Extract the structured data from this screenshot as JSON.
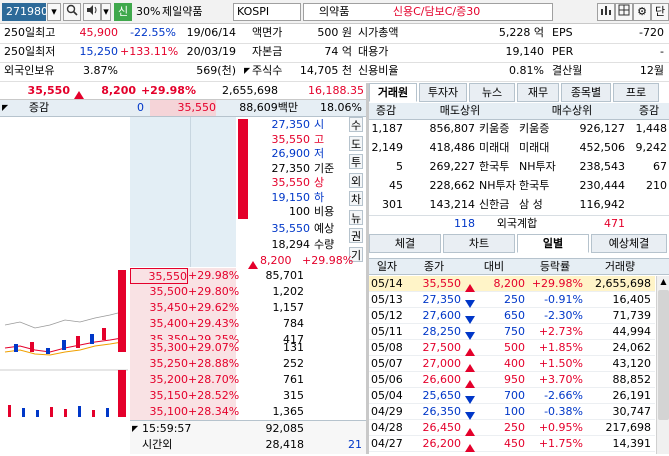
{
  "toolbar": {
    "code": "271980",
    "market_badge": "신",
    "margin": "30%",
    "name": "제일약품",
    "market": "KOSPI",
    "sector": "의약품",
    "credit": "신용C/담보C/증30",
    "end_btn": "단"
  },
  "info": {
    "row1": {
      "l1": "250일최고",
      "v1": "45,900",
      "p1": "-22.55%",
      "d1": "19/06/14",
      "l2": "액면가",
      "v2": "500 원",
      "l3": "시가총액",
      "v3": "5,228 억",
      "l4": "EPS",
      "v4": "-720"
    },
    "row2": {
      "l1": "250일최저",
      "v1": "15,250",
      "p1": "+133.11%",
      "d1": "20/03/19",
      "l2": "자본금",
      "v2": "74 억",
      "l3": "대용가",
      "v3": "19,140",
      "l4": "PER",
      "v4": "-"
    },
    "row3": {
      "l1": "외국인보유",
      "v1": "3.87%",
      "v1b": "569(천)",
      "l2": "주식수",
      "v2": "14,705 천",
      "l3": "신용비율",
      "v3": "0.81%",
      "l4": "결산월",
      "v4": "12월"
    }
  },
  "pricebar": {
    "price": "35,550",
    "change": "8,200",
    "rate": "+29.98%",
    "volume": "2,655,698",
    "amount": "16,188.35"
  },
  "order": {
    "hdr_label": "증감",
    "hdr_zero": "0",
    "hdr_price": "35,550",
    "hdr_amount": "88,609백만",
    "hdr_pct": "18.06%",
    "ohlc": [
      {
        "val": "27,350",
        "label": "시",
        "color": "blue"
      },
      {
        "val": "35,550",
        "label": "고",
        "color": "red"
      },
      {
        "val": "26,900",
        "label": "저",
        "color": "blue"
      },
      {
        "val": "27,350",
        "label": "기준",
        "color": "black"
      },
      {
        "val": "35,550",
        "label": "상",
        "color": "red"
      },
      {
        "val": "19,150",
        "label": "하",
        "color": "blue"
      },
      {
        "val": "100",
        "label": "비용",
        "color": "black"
      }
    ],
    "expected_label": "예상",
    "expected_val": "35,550",
    "qty_label": "수량",
    "qty_val": "18,294",
    "exp_change": "8,200",
    "exp_rate": "+29.98%",
    "side_menu": [
      "수",
      "도",
      "투",
      "외",
      "차",
      "뉴",
      "권",
      "기"
    ],
    "ask_rows": [
      {
        "price": "35,550",
        "rate": "+29.98%",
        "qty": "85,701"
      },
      {
        "price": "35,500",
        "rate": "+29.80%",
        "qty": "1,202"
      },
      {
        "price": "35,450",
        "rate": "+29.62%",
        "qty": "1,157"
      },
      {
        "price": "35,400",
        "rate": "+29.43%",
        "qty": "784"
      },
      {
        "price": "35,350",
        "rate": "+29.25%",
        "qty": "417"
      }
    ],
    "bid_rows": [
      {
        "price": "35,300",
        "rate": "+29.07%",
        "qty": "131"
      },
      {
        "price": "35,250",
        "rate": "+28.88%",
        "qty": "252"
      },
      {
        "price": "35,200",
        "rate": "+28.70%",
        "qty": "761"
      },
      {
        "price": "35,150",
        "rate": "+28.52%",
        "qty": "315"
      },
      {
        "price": "35,100",
        "rate": "+28.34%",
        "qty": "1,365"
      }
    ],
    "time": "15:59:57",
    "total": "92,085",
    "after_label": "시간외",
    "after_val": "28,418",
    "after_extra": "21"
  },
  "right_tabs": [
    "거래원",
    "투자자",
    "뉴스",
    "재무",
    "종목별",
    "프로"
  ],
  "broker": {
    "headers": [
      "증감",
      "매도상위",
      "매수상위",
      "증감"
    ],
    "rows": [
      {
        "d1": "1,187",
        "sv": "856,807",
        "sn": "키움증",
        "bn": "키움증",
        "bv": "926,127",
        "d2": "1,448"
      },
      {
        "d1": "2,149",
        "sv": "418,486",
        "sn": "미래대",
        "bn": "미래대",
        "bv": "452,506",
        "d2": "9,242"
      },
      {
        "d1": "5",
        "sv": "269,227",
        "sn": "한국투",
        "bn": "NH투자",
        "bv": "238,543",
        "d2": "67"
      },
      {
        "d1": "45",
        "sv": "228,662",
        "sn": "NH투자",
        "bn": "한국투",
        "bv": "230,444",
        "d2": "210"
      },
      {
        "d1": "301",
        "sv": "143,214",
        "sn": "신한금",
        "bn": "삼  성",
        "bv": "116,942",
        "d2": ""
      }
    ],
    "foreign_left": "118",
    "foreign_label": "외국계합",
    "foreign_right": "471"
  },
  "bottom_tabs": [
    "체결",
    "차트",
    "일별",
    "예상체결"
  ],
  "daily": {
    "headers": [
      "일자",
      "종가",
      "대비",
      "등락률",
      "거래량"
    ],
    "rows": [
      {
        "date": "05/14",
        "close": "35,550",
        "dir": "up",
        "chg": "8,200",
        "rate": "+29.98%",
        "vol": "2,655,698"
      },
      {
        "date": "05/13",
        "close": "27,350",
        "dir": "dn",
        "chg": "250",
        "rate": "-0.91%",
        "vol": "16,405"
      },
      {
        "date": "05/12",
        "close": "27,600",
        "dir": "dn",
        "chg": "650",
        "rate": "-2.30%",
        "vol": "71,739"
      },
      {
        "date": "05/11",
        "close": "28,250",
        "dir": "dn",
        "chg": "750",
        "rate": "+2.73%",
        "vol": "44,994"
      },
      {
        "date": "05/08",
        "close": "27,500",
        "dir": "up",
        "chg": "500",
        "rate": "+1.85%",
        "vol": "24,062"
      },
      {
        "date": "05/07",
        "close": "27,000",
        "dir": "up",
        "chg": "400",
        "rate": "+1.50%",
        "vol": "43,120"
      },
      {
        "date": "05/06",
        "close": "26,600",
        "dir": "up",
        "chg": "950",
        "rate": "+3.70%",
        "vol": "88,852"
      },
      {
        "date": "05/04",
        "close": "25,650",
        "dir": "dn",
        "chg": "700",
        "rate": "-2.66%",
        "vol": "26,191"
      },
      {
        "date": "04/29",
        "close": "26,350",
        "dir": "dn",
        "chg": "100",
        "rate": "-0.38%",
        "vol": "30,747"
      },
      {
        "date": "04/28",
        "close": "26,450",
        "dir": "up",
        "chg": "250",
        "rate": "+0.95%",
        "vol": "217,698"
      },
      {
        "date": "04/27",
        "close": "26,200",
        "dir": "up",
        "chg": "450",
        "rate": "+1.75%",
        "vol": "14,391"
      }
    ]
  },
  "colors": {
    "up": "#e4002b",
    "down": "#0037c8",
    "accent": "#2d6a99"
  }
}
